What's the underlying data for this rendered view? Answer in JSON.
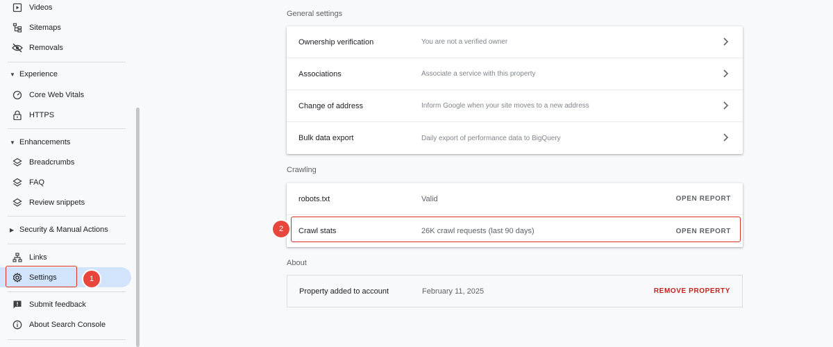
{
  "sidebar": {
    "items": [
      {
        "label": "Videos",
        "icon": "video-icon"
      },
      {
        "label": "Sitemaps",
        "icon": "sitemap-icon"
      },
      {
        "label": "Removals",
        "icon": "eye-off-icon"
      },
      {
        "label": "Core Web Vitals",
        "icon": "gauge-icon"
      },
      {
        "label": "HTTPS",
        "icon": "lock-icon"
      },
      {
        "label": "Breadcrumbs",
        "icon": "layers-icon"
      },
      {
        "label": "FAQ",
        "icon": "layers-icon"
      },
      {
        "label": "Review snippets",
        "icon": "layers-icon"
      },
      {
        "label": "Links",
        "icon": "links-icon"
      },
      {
        "label": "Settings",
        "icon": "gear-icon"
      },
      {
        "label": "Submit feedback",
        "icon": "feedback-icon"
      },
      {
        "label": "About Search Console",
        "icon": "info-icon"
      }
    ],
    "sections": {
      "experience": "Experience",
      "enhancements": "Enhancements",
      "security": "Security & Manual Actions"
    },
    "active": "Settings"
  },
  "general": {
    "title": "General settings",
    "rows": [
      {
        "title": "Ownership verification",
        "desc": "You are not a verified owner"
      },
      {
        "title": "Associations",
        "desc": "Associate a service with this property"
      },
      {
        "title": "Change of address",
        "desc": "Inform Google when your site moves to a new address"
      },
      {
        "title": "Bulk data export",
        "desc": "Daily export of performance data to BigQuery"
      }
    ]
  },
  "crawling": {
    "title": "Crawling",
    "rows": [
      {
        "title": "robots.txt",
        "desc": "Valid",
        "action": "OPEN REPORT"
      },
      {
        "title": "Crawl stats",
        "desc": "26K crawl requests (last 90 days)",
        "action": "OPEN REPORT"
      }
    ]
  },
  "about": {
    "title": "About",
    "row": {
      "title": "Property added to account",
      "desc": "February 11, 2025",
      "action": "REMOVE PROPERTY"
    }
  },
  "annotations": {
    "badge1": "1",
    "badge2": "2"
  },
  "colors": {
    "accent_active": "#d2e3fc",
    "annotation_red": "#e8453c",
    "danger": "#c5221f"
  }
}
